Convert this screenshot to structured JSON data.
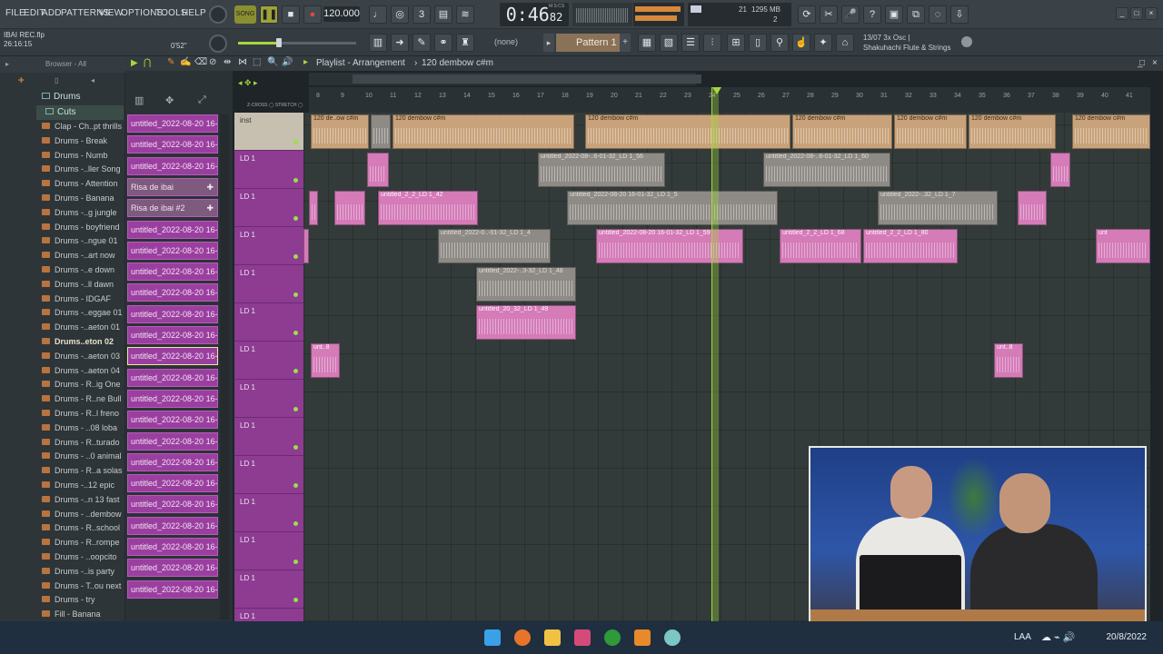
{
  "menu": [
    "FILE",
    "EDIT",
    "ADD",
    "PATTERNS",
    "VIEW",
    "OPTIONS",
    "TOOLS",
    "HELP"
  ],
  "transport": {
    "song_label": "SONG",
    "bpm": "120.000",
    "time_main": "0:46",
    "time_sub": "82",
    "time_unit": "M:S:CS",
    "cpu_ram": "1295 MB",
    "cpu_val": "21",
    "poly": "2"
  },
  "file": {
    "name": "IBAI REC.flp",
    "time": "26:16:15",
    "hint": "0'52\""
  },
  "pattern": {
    "label": "Pattern 1",
    "none_label": "(none)"
  },
  "hint_panel": {
    "line1": "13/07  3x Osc |",
    "line2": "Shakuhachi Flute & Strings"
  },
  "browser": {
    "title": "Browser - All",
    "folder": "Drums",
    "subfolder": "Cuts",
    "items": [
      "Clap - Ch..pt thrills",
      "Drums - Break",
      "Drums - Numb",
      "Drums -..ller Song",
      "Drums - Attention",
      "Drums - Banana",
      "Drums -..g jungle",
      "Drums - boyfriend",
      "Drums -..ngue 01",
      "Drums -..art now",
      "Drums -..e down",
      "Drums -..ll dawn",
      "Drums - IDGAF",
      "Drums -..eggae 01",
      "Drums -..aeton 01",
      "Drums..eton 02",
      "Drums -..aeton 03",
      "Drums -..aeton 04",
      "Drums - R..ig One",
      "Drums - R..ne Bull",
      "Drums - R..l freno",
      "Drums - ..08 loba",
      "Drums - R..turado",
      "Drums - ..0 animal",
      "Drums - R..a solas",
      "Drums -..12 epic",
      "Drums -..n 13 fast",
      "Drums - ..dembow",
      "Drums - R..school",
      "Drums - R..rompe",
      "Drums - ..oopcito",
      "Drums -..is party",
      "Drums - T..ou next",
      "Drums - try",
      "Fill - Banana"
    ]
  },
  "channels": [
    "untitled_2022-08-20 16-",
    "untitled_2022-08-20 16-",
    "untitled_2022-08-20 16-",
    "Risa de ibai",
    "Risa de ibai #2",
    "untitled_2022-08-20 16-",
    "untitled_2022-08-20 16-",
    "untitled_2022-08-20 16-",
    "untitled_2022-08-20 16-",
    "untitled_2022-08-20 16-",
    "untitled_2022-08-20 16-",
    "untitled_2022-08-20 16-",
    "untitled_2022-08-20 16-",
    "untitled_2022-08-20 16-",
    "untitled_2022-08-20 16-",
    "untitled_2022-08-20 16-",
    "untitled_2022-08-20 16-",
    "untitled_2022-08-20 16-",
    "untitled_2022-08-20 16-",
    "untitled_2022-08-20 16-",
    "untitled_2022-08-20 16-",
    "untitled_2022-08-20 16-",
    "untitled_2022-08-20 16-"
  ],
  "playlist": {
    "title": "Playlist - Arrangement",
    "pattern_name": "120 dembow c#m",
    "tracks": [
      "inst",
      "LD 1",
      "LD 1",
      "LD 1",
      "LD 1",
      "LD 1",
      "LD 1",
      "LD 1",
      "LD 1",
      "LD 1",
      "LD 1",
      "LD 1",
      "LD 1",
      "LD 1"
    ],
    "ruler": [
      "8",
      "9",
      "10",
      "11",
      "12",
      "13",
      "14",
      "15",
      "16",
      "17",
      "18",
      "19",
      "20",
      "21",
      "22",
      "23",
      "24",
      "25",
      "26",
      "27",
      "28",
      "29",
      "30",
      "31",
      "32",
      "33",
      "34",
      "35",
      "36",
      "37",
      "38",
      "39",
      "40",
      "41"
    ],
    "clips": {
      "c1": "120 de..ow c#m",
      "c2": "120 dembow c#m",
      "c3": "120 dembow c#m",
      "c4": "120 dembow c#m",
      "c5": "120 dembow c#m",
      "c6": "120 dembow c#m",
      "c7": "120 dembow c#m",
      "p1": "untitled_2_2_LD 1_42",
      "p2": "untitled_2022-08-20 16-01-32_LD 1_59",
      "p3": "untitled_2_2_LD 1_68",
      "p4": "untitled_2_2_LD 1_80",
      "p5": "untitled_20_32_LD 1_49",
      "p6": "unt..8",
      "p7": "unt..8",
      "p8": "unt",
      "d1": "untitled_2022-08-..6-01-32_LD 1_56",
      "d2": "untitled_2022-08-20 16-01-32_LD 1_5",
      "d3": "untitled_2022-08-..6-01-32_LD 1_60",
      "d4": "untitled_2022-..32_LD 1_7",
      "d5": "untitled_2022-0..-01-32_LD 1_4",
      "d6": "untitled_2022-..3-32_LD 1_48"
    }
  },
  "taskbar": {
    "lang": "LAA",
    "date": "20/8/2022"
  },
  "colors": {
    "accent_green": "#a6d83c",
    "channel_purple": "#9a3f9f",
    "clip_pink": "#d47bb8",
    "clip_inst": "#c8a27a"
  }
}
